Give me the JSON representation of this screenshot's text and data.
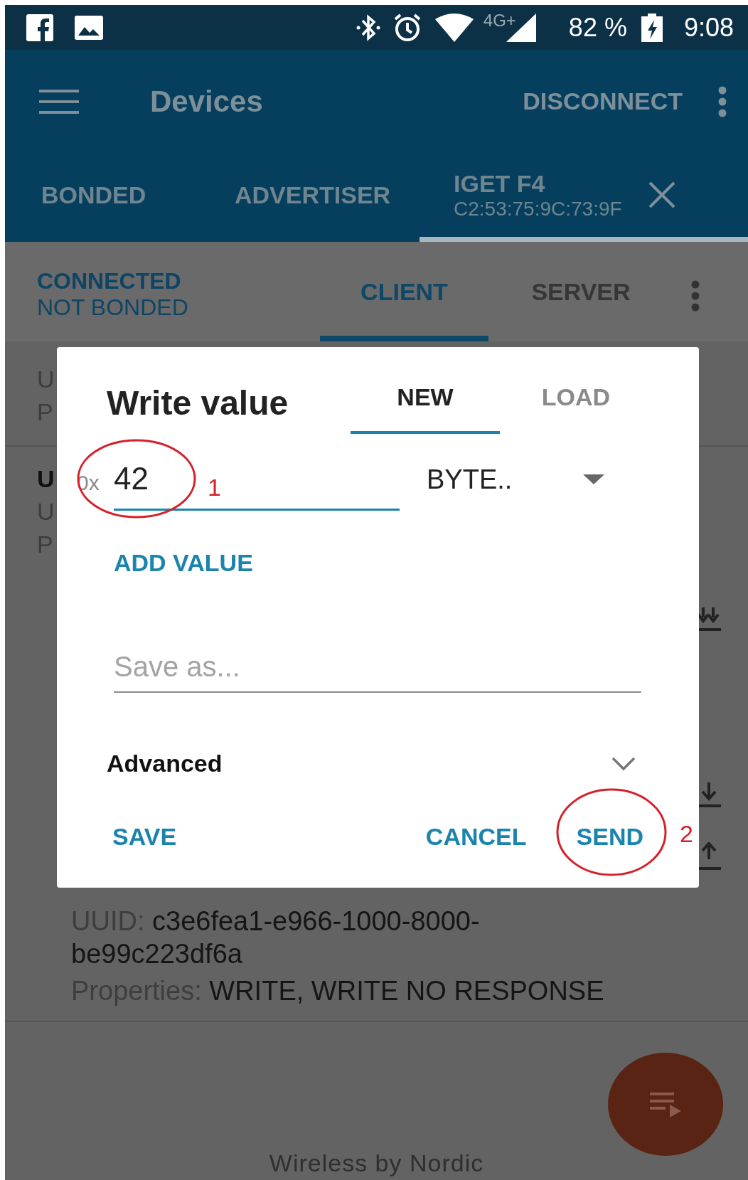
{
  "status_bar": {
    "network": "4G+",
    "battery": "82 %",
    "time": "9:08"
  },
  "app_bar": {
    "title": "Devices",
    "action": "DISCONNECT"
  },
  "device_tabs": [
    {
      "label": "BONDED",
      "selected": false
    },
    {
      "label": "ADVERTISER",
      "selected": false
    },
    {
      "label": "IGET F4",
      "subtitle": "C2:53:75:9C:73:9F",
      "selected": true
    }
  ],
  "connection": {
    "state": "CONNECTED",
    "bond": "NOT BONDED"
  },
  "mode_tabs": [
    {
      "label": "CLIENT",
      "selected": true
    },
    {
      "label": "SERVER",
      "selected": false
    }
  ],
  "background_rows": [
    {
      "fragments": [
        {
          "kind": "label",
          "text": "U"
        },
        {
          "kind": "label",
          "text": "P"
        }
      ]
    },
    {
      "fragments": [
        {
          "kind": "title",
          "text": "U"
        },
        {
          "kind": "label",
          "text": "U"
        },
        {
          "kind": "label",
          "text": "P"
        }
      ]
    }
  ],
  "characteristic": {
    "uuid_label": "UUID:",
    "uuid": "c3e6fea1-e966-1000-8000-be99c223df6a",
    "properties_label": "Properties:",
    "properties": "WRITE, WRITE NO RESPONSE"
  },
  "dialog": {
    "title": "Write value",
    "tabs": [
      {
        "label": "NEW",
        "selected": true
      },
      {
        "label": "LOAD",
        "selected": false
      }
    ],
    "prefix": "0x",
    "value": "42",
    "type": "BYTE..",
    "add_button": "ADD VALUE",
    "save_as_placeholder": "Save as...",
    "advanced": {
      "label": "Advanced",
      "expanded": false
    },
    "buttons": [
      "SAVE",
      "CANCEL",
      "SEND"
    ]
  },
  "annotations": [
    {
      "number": "1"
    },
    {
      "number": "2"
    }
  ],
  "footer": "Wireless by Nordic"
}
